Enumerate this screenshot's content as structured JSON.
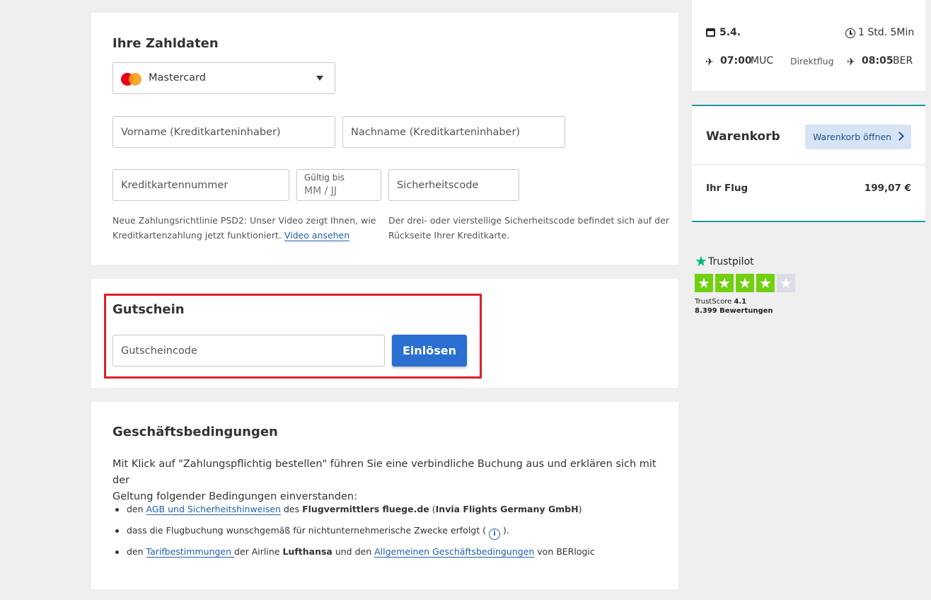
{
  "payment": {
    "title": "Ihre Zahldaten",
    "card_type": "Mastercard",
    "firstname_placeholder": "Vorname (Kreditkarteninhaber)",
    "lastname_placeholder": "Nachname (Kreditkarteninhaber)",
    "cardnumber_placeholder": "Kreditkartennummer",
    "expiry_label": "Gültig bis",
    "expiry_placeholder": "MM / JJ",
    "cvc_placeholder": "Sicherheitscode",
    "psd2_note_line1": "Neue Zahlungsrichtlinie PSD2: Unser Video zeigt Ihnen, wie",
    "psd2_note_line2": "Kreditkartenzahlung jetzt funktioniert.",
    "psd2_link": "Video ansehen",
    "cvc_note_line1": "Der drei- oder vierstellige Sicherheitscode befindet sich auf der",
    "cvc_note_line2": "Rückseite Ihrer Kreditkarte."
  },
  "voucher": {
    "title": "Gutschein",
    "placeholder": "Gutscheincode",
    "button": "Einlösen"
  },
  "terms": {
    "title": "Geschäftsbedingungen",
    "intro_line1": "Mit Klick auf \"Zahlungspflichtig bestellen\" führen Sie eine verbindliche Buchung aus und erklären sich mit der",
    "intro_line2": "Geltung folgender Bedingungen einverstanden:",
    "b1_pre": "den ",
    "b1_link": "AGB und Sicherheitshinweisen",
    "b1_mid": " des ",
    "b1_bold1": "Flugvermittlers fluege.de",
    "b1_mid2": " (",
    "b1_bold2": "Invia Flights Germany GmbH",
    "b1_post": ")",
    "b2_text": "dass die Flugbuchung wunschgemäß für nichtunternehmerische Zwecke erfolgt (",
    "b2_post": ").",
    "b3_pre": "den ",
    "b3_link1": "Tarifbestimmungen ",
    "b3_mid": " der Airline ",
    "b3_bold": "Lufthansa",
    "b3_mid2": " und den ",
    "b3_link2": "Allgemeinen Geschäftsbedingungen",
    "b3_post": " von BERlogic"
  },
  "flight": {
    "date": "5.4.",
    "duration": "1 Std. 5Min",
    "dep_time": "07:00",
    "dep_airport": "MUC",
    "type": "Direktflug",
    "arr_time": "08:05",
    "arr_airport": "BER"
  },
  "cart": {
    "title": "Warenkorb",
    "open_button": "Warenkorb öffnen",
    "item_label": "Ihr Flug",
    "item_price": "199,07 €"
  },
  "trustpilot": {
    "brand": "Trustpilot",
    "score_label": "TrustScore",
    "score": "4.1",
    "reviews": "8.399 Bewertungen",
    "rating": 4.1
  },
  "colors": {
    "accent_blue": "#2a6fd1",
    "highlight_red": "#d9222a",
    "teal_border": "#1e9aa0",
    "trustpilot_green": "#00b67a"
  }
}
